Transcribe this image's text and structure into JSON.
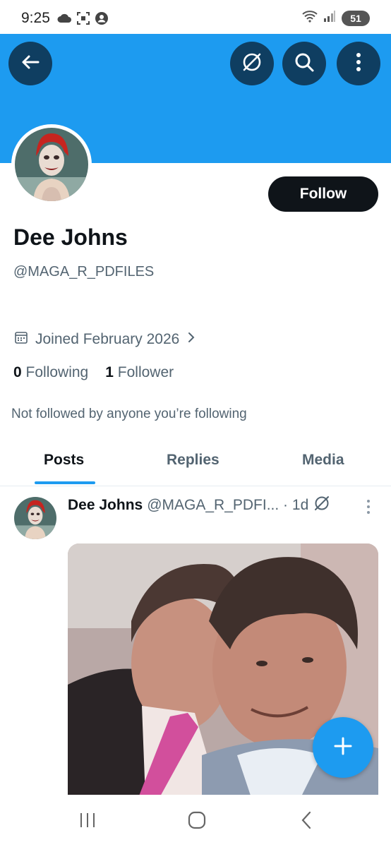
{
  "status_bar": {
    "time": "9:25",
    "battery": "51",
    "icons": [
      "cloud-icon",
      "screenshot-icon",
      "account-icon",
      "wifi-icon",
      "signal-icon",
      "battery-icon"
    ]
  },
  "header": {
    "banner_color": "#1d9bf0",
    "buttons": [
      "back-icon",
      "grok-icon",
      "search-icon",
      "more-icon"
    ]
  },
  "profile": {
    "follow_label": "Follow",
    "name": "Dee Johns",
    "handle": "@MAGA_R_PDFILES",
    "joined": "Joined February 2026",
    "following_count": "0",
    "following_label": "Following",
    "followers_count": "1",
    "followers_label": "Follower",
    "not_followed": "Not followed by anyone you’re following"
  },
  "tabs": [
    {
      "label": "Posts",
      "active": true
    },
    {
      "label": "Replies",
      "active": false
    },
    {
      "label": "Media",
      "active": false
    }
  ],
  "post": {
    "name": "Dee Johns",
    "meta": "@MAGA_R_PDFI... · 1d"
  },
  "colors": {
    "accent": "#1d9bf0",
    "dark_button": "#0f1419",
    "header_button": "#0f3e61"
  }
}
